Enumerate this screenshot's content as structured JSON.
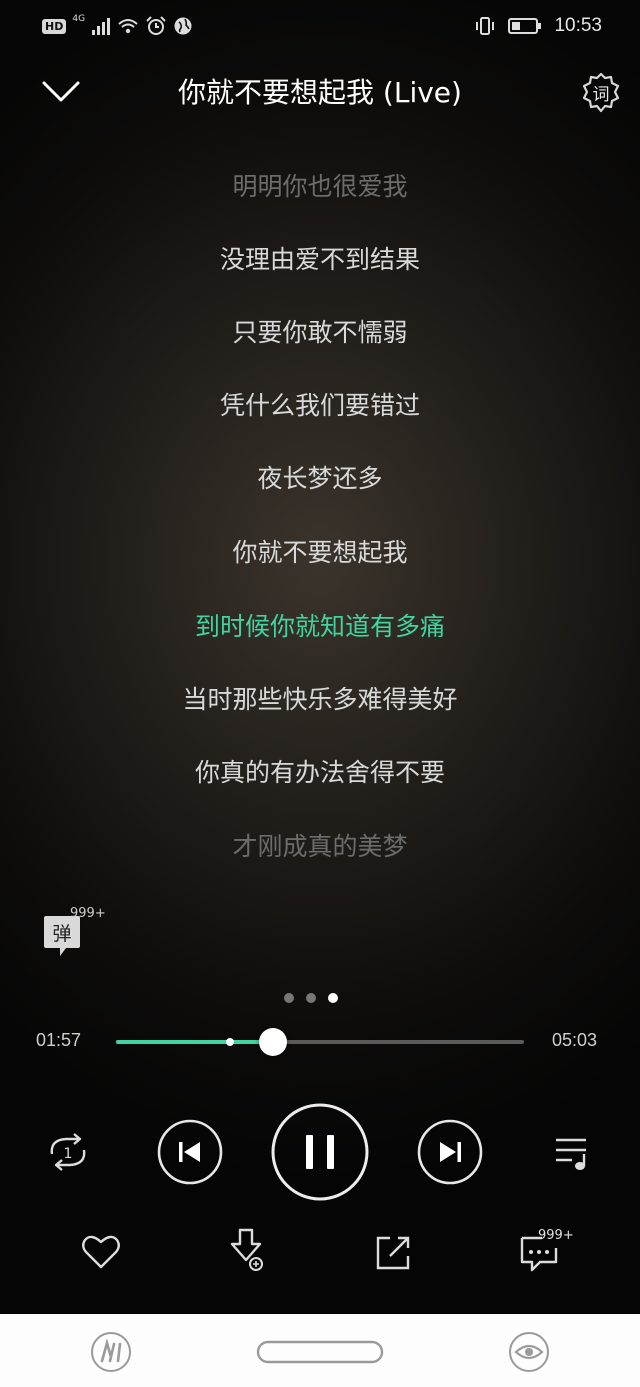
{
  "status_bar": {
    "hd": "HD",
    "network": "4G",
    "time": "10:53",
    "icons": [
      "signal-icon",
      "wifi-icon",
      "alarm-icon",
      "globe-icon",
      "vibrate-icon",
      "battery-icon"
    ]
  },
  "header": {
    "title": "你就不要想起我 (Live)",
    "lyric_settings_label": "词"
  },
  "lyrics": [
    {
      "text": "明明你也很爱我",
      "state": "fade"
    },
    {
      "text": "没理由爱不到结果",
      "state": "normal"
    },
    {
      "text": "只要你敢不懦弱",
      "state": "normal"
    },
    {
      "text": "凭什么我们要错过",
      "state": "normal"
    },
    {
      "text": "夜长梦还多",
      "state": "normal"
    },
    {
      "text": "你就不要想起我",
      "state": "normal"
    },
    {
      "text": "到时候你就知道有多痛",
      "state": "active"
    },
    {
      "text": "当时那些快乐多难得美好",
      "state": "normal"
    },
    {
      "text": "你真的有办法舍得不要",
      "state": "normal"
    },
    {
      "text": "才刚成真的美梦",
      "state": "fade"
    }
  ],
  "danmu": {
    "label": "弹",
    "count": "999+"
  },
  "pager": {
    "count": 3,
    "active_index": 2
  },
  "progress": {
    "elapsed": "01:57",
    "total": "05:03",
    "played_fraction": 0.386,
    "buffered_fraction": 0.28
  },
  "controls": {
    "loop_badge": "1"
  },
  "actions": {
    "comment_count": "999+"
  },
  "colors": {
    "accent": "#3fd4a0",
    "lyric": "#d9d9d9",
    "lyric_fade": "#6c6c6c"
  }
}
